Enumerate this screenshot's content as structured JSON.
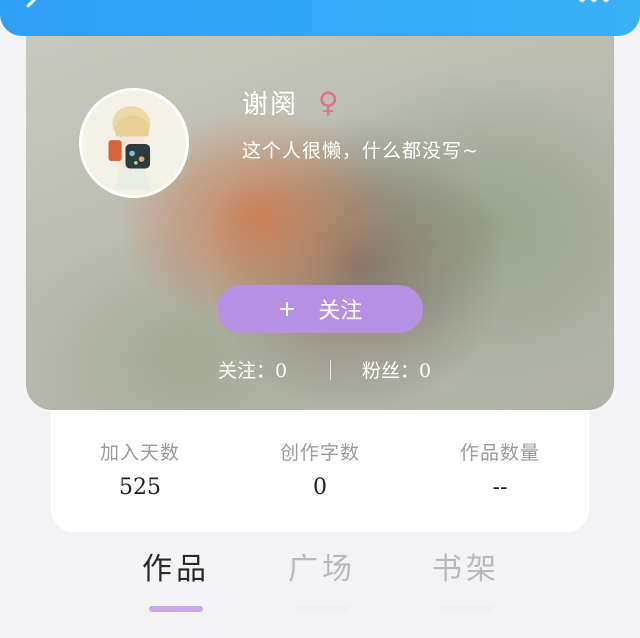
{
  "topbar": {
    "back_icon": "chevron-left-icon",
    "more_icon": "more-dots-icon",
    "color": "#2f9ef5"
  },
  "profile": {
    "username": "谢阕",
    "gender_symbol": "♀",
    "gender_color": "#e56e8c",
    "bio": "这个人很懒，什么都没写~",
    "follow_button": {
      "plus": "+",
      "label": "关注",
      "color": "#b691e3"
    },
    "following": "关注：0",
    "fans": "粉丝：0"
  },
  "info": [
    {
      "label": "加入天数",
      "value": "525"
    },
    {
      "label": "创作字数",
      "value": "0"
    },
    {
      "label": "作品数量",
      "value": "--"
    }
  ],
  "tabs": [
    {
      "label": "作品",
      "active": true
    },
    {
      "label": "广场",
      "active": false
    },
    {
      "label": "书架",
      "active": false
    }
  ],
  "accent": "#c8a6ea"
}
